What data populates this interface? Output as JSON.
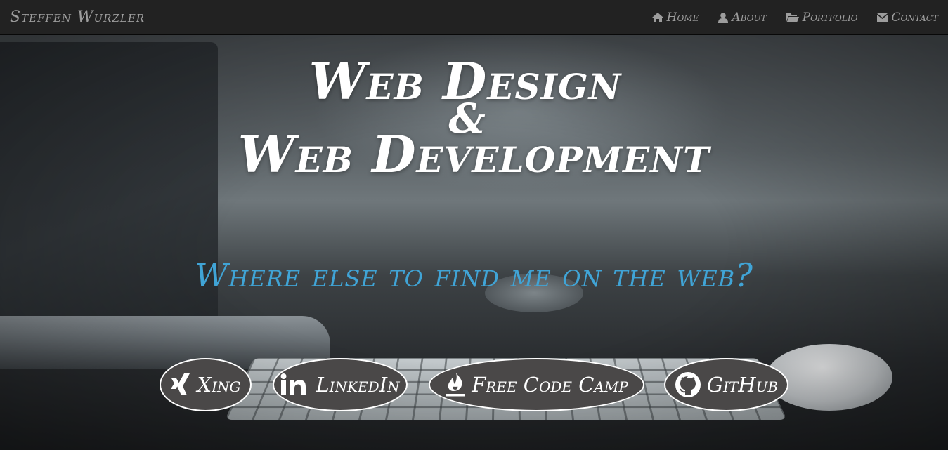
{
  "navbar": {
    "brand": "Steffen Wurzler",
    "links": [
      {
        "label": "Home",
        "icon": "home-icon"
      },
      {
        "label": "About",
        "icon": "user-icon"
      },
      {
        "label": "Portfolio",
        "icon": "folder-open-icon"
      },
      {
        "label": "Contact",
        "icon": "envelope-icon"
      }
    ]
  },
  "hero": {
    "title_line1": "Web Design",
    "title_amp": "&",
    "title_line2": "Web Development",
    "subtitle": "Where else to find me on the web?",
    "social": [
      {
        "label": "Xing",
        "icon": "xing-icon"
      },
      {
        "label": "LinkedIn",
        "icon": "linkedin-icon"
      },
      {
        "label": "Free Code Camp",
        "icon": "free-code-camp-icon"
      },
      {
        "label": "GitHub",
        "icon": "github-icon"
      }
    ]
  },
  "colors": {
    "navbar_bg": "#222222",
    "nav_text": "#9d9d9d",
    "headline": "#ffffff",
    "subheadline": "#40a4d6",
    "social_button_bg": "#4a4848",
    "social_button_border": "#ffffff"
  }
}
